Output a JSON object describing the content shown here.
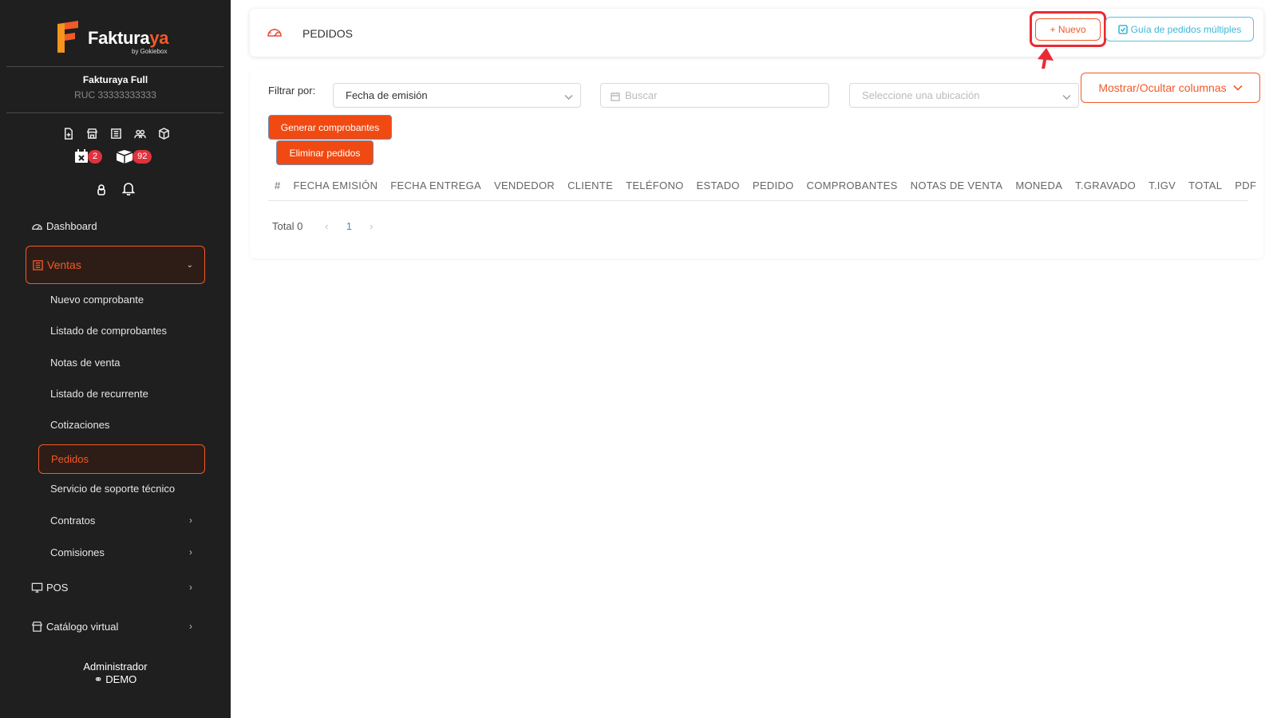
{
  "brand": {
    "name_main": "Faktura",
    "name_accent": "ya",
    "tagline": "by Gokiebox"
  },
  "company": {
    "name": "Fakturaya Full",
    "ruc": "RUC 33333333333"
  },
  "badges": {
    "calendar_count": "2",
    "inbox_count": "92"
  },
  "sidebar": {
    "dashboard": "Dashboard",
    "ventas": "Ventas",
    "ventas_items": {
      "nuevo": "Nuevo comprobante",
      "listado": "Listado de comprobantes",
      "notas": "Notas de venta",
      "recurrente": "Listado de recurrente",
      "cotizaciones": "Cotizaciones",
      "pedidos": "Pedidos",
      "servicio": "Servicio de soporte técnico",
      "contratos": "Contratos",
      "comisiones": "Comisiones"
    },
    "pos": "POS",
    "catalogo": "Catálogo virtual"
  },
  "user": {
    "role": "Administrador",
    "name": "DEMO"
  },
  "header": {
    "title": "PEDIDOS",
    "nuevo_label": "+ Nuevo",
    "guia_label": "Guía de pedidos múltiples"
  },
  "filters": {
    "label": "Filtrar por:",
    "date_select": "Fecha de emisión",
    "search_placeholder": "Buscar",
    "location_placeholder": "Seleccione una ubicación",
    "columns_button": "Mostrar/Ocultar columnas"
  },
  "actions": {
    "generar": "Generar comprobantes",
    "eliminar": "Eliminar pedidos"
  },
  "table": {
    "columns": [
      "#",
      "FECHA EMISIÓN",
      "FECHA ENTREGA",
      "VENDEDOR",
      "CLIENTE",
      "TELÉFONO",
      "ESTADO",
      "PEDIDO",
      "COMPROBANTES",
      "NOTAS DE VENTA",
      "MONEDA",
      "T.GRAVADO",
      "T.IGV",
      "TOTAL",
      "PDF"
    ]
  },
  "pagination": {
    "total": "Total 0",
    "current_page": "1"
  },
  "colors": {
    "accent": "#f05a28",
    "sidebar_bg": "#1f1f1f",
    "highlight": "#ea2a32",
    "info": "#3fb6d8"
  }
}
